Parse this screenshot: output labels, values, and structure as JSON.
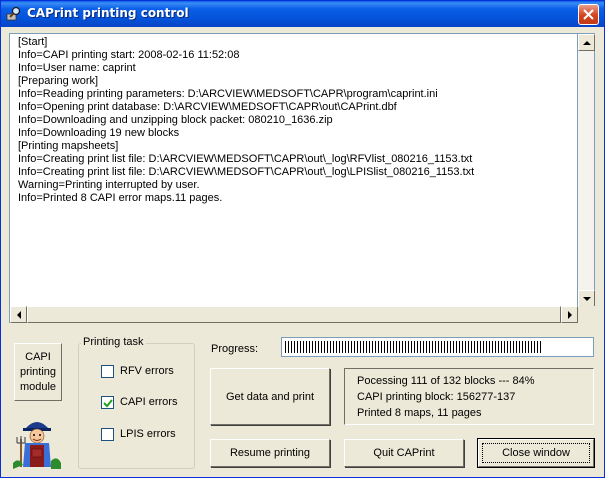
{
  "window": {
    "title": "CAPrint printing control",
    "app_icon": "magnifier-printer-icon",
    "close_icon": "close-icon"
  },
  "log": {
    "lines": [
      "[Start]",
      "Info=CAPI printing start: 2008-02-16 11:52:08",
      "Info=User name: caprint",
      "[Preparing work]",
      "Info=Reading printing parameters: D:\\ARCVIEW\\MEDSOFT\\CAPR\\program\\caprint.ini",
      "Info=Opening print database: D:\\ARCVIEW\\MEDSOFT\\CAPR\\out\\CAPrint.dbf",
      "Info=Downloading and unzipping block packet: 080210_1636.zip",
      "Info=Downloading 19 new blocks",
      "[Printing mapsheets]",
      "Info=Creating print list file: D:\\ARCVIEW\\MEDSOFT\\CAPR\\out\\_log\\RFVlist_080216_1153.txt",
      "Info=Creating print list file: D:\\ARCVIEW\\MEDSOFT\\CAPR\\out\\_log\\LPISlist_080216_1153.txt",
      "Warning=Printing interrupted by user.",
      "Info=Printed 8 CAPI error maps.11 pages."
    ]
  },
  "module": {
    "label_lines": [
      "CAPI",
      "printing",
      "module"
    ],
    "mascot": "farmer-mascot-icon"
  },
  "printing_task": {
    "title": "Printing task",
    "options": [
      {
        "label": "RFV errors",
        "checked": false
      },
      {
        "label": "CAPI errors",
        "checked": true
      },
      {
        "label": "LPIS errors",
        "checked": false
      }
    ]
  },
  "progress": {
    "label": "Progress:",
    "fraction": 0.84
  },
  "status": {
    "lines": [
      "Pocessing 111 of 132 blocks  ---  84%",
      "CAPI printing block: 156277-137",
      "Printed 8 maps, 11 pages"
    ]
  },
  "buttons": {
    "get_data": "Get data and print",
    "resume": "Resume printing",
    "quit": "Quit CAPrint",
    "close": "Close window"
  },
  "colors": {
    "titlebar": "#0A5FE8",
    "face": "#ECE9D8",
    "close_button": "#D5421E"
  }
}
